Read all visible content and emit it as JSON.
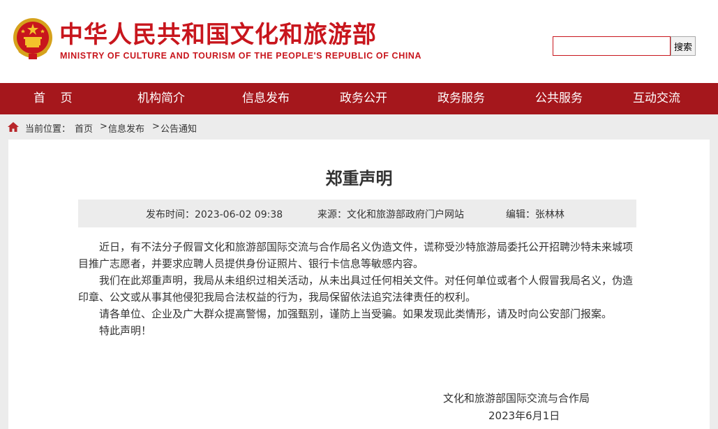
{
  "header": {
    "site_title": "中华人民共和国文化和旅游部",
    "site_subtitle": "MINISTRY OF CULTURE AND TOURISM OF THE PEOPLE'S REPUBLIC OF CHINA",
    "emblem_icon": "national-emblem-icon",
    "search": {
      "value": "",
      "placeholder": "",
      "button_label": "搜索"
    }
  },
  "colors": {
    "brand_red": "#c8161d",
    "nav_red": "#a5171c",
    "page_bg": "#ececec",
    "meta_bg": "#ececec"
  },
  "nav": {
    "items": [
      {
        "label": "首    页"
      },
      {
        "label": "机构简介"
      },
      {
        "label": "信息发布"
      },
      {
        "label": "政务公开"
      },
      {
        "label": "政务服务"
      },
      {
        "label": "公共服务"
      },
      {
        "label": "互动交流"
      }
    ]
  },
  "breadcrumb": {
    "icon": "home-icon",
    "label": "当前位置：",
    "links": [
      {
        "label": "首页"
      },
      {
        "label": "信息发布"
      },
      {
        "label": "公告通知"
      }
    ],
    "separator": ">"
  },
  "article": {
    "title": "郑重声明",
    "meta": {
      "published": "发布时间：2023-06-02 09:38",
      "source": "来源：文化和旅游部政府门户网站",
      "editor": "编辑：张林林"
    },
    "paragraphs": [
      "近日，有不法分子假冒文化和旅游部国际交流与合作局名义伪造文件，谎称受沙特旅游局委托公开招聘沙特未来城项目推广志愿者，并要求应聘人员提供身份证照片、银行卡信息等敏感内容。",
      "我们在此郑重声明，我局从未组织过相关活动，从未出具过任何相关文件。对任何单位或者个人假冒我局名义，伪造印章、公文或从事其他侵犯我局合法权益的行为，我局保留依法追究法律责任的权利。",
      "请各单位、企业及广大群众提高警惕，加强甄别，谨防上当受骗。如果发现此类情形，请及时向公安部门报案。",
      "特此声明！"
    ],
    "signature": {
      "org": "文化和旅游部国际交流与合作局",
      "date": "2023年6月1日"
    }
  }
}
